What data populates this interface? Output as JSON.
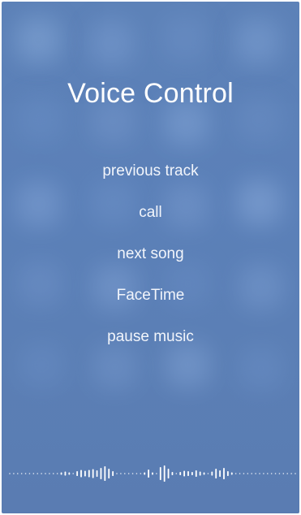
{
  "title": "Voice Control",
  "suggestions": [
    {
      "label": "previous track"
    },
    {
      "label": "call"
    },
    {
      "label": "next song"
    },
    {
      "label": "FaceTime"
    },
    {
      "label": "pause music"
    }
  ],
  "colors": {
    "background": "#5b80b8",
    "text": "#ffffff",
    "waveform": "#ffffff"
  },
  "icons": {
    "waveform": "audio-waveform-icon"
  }
}
